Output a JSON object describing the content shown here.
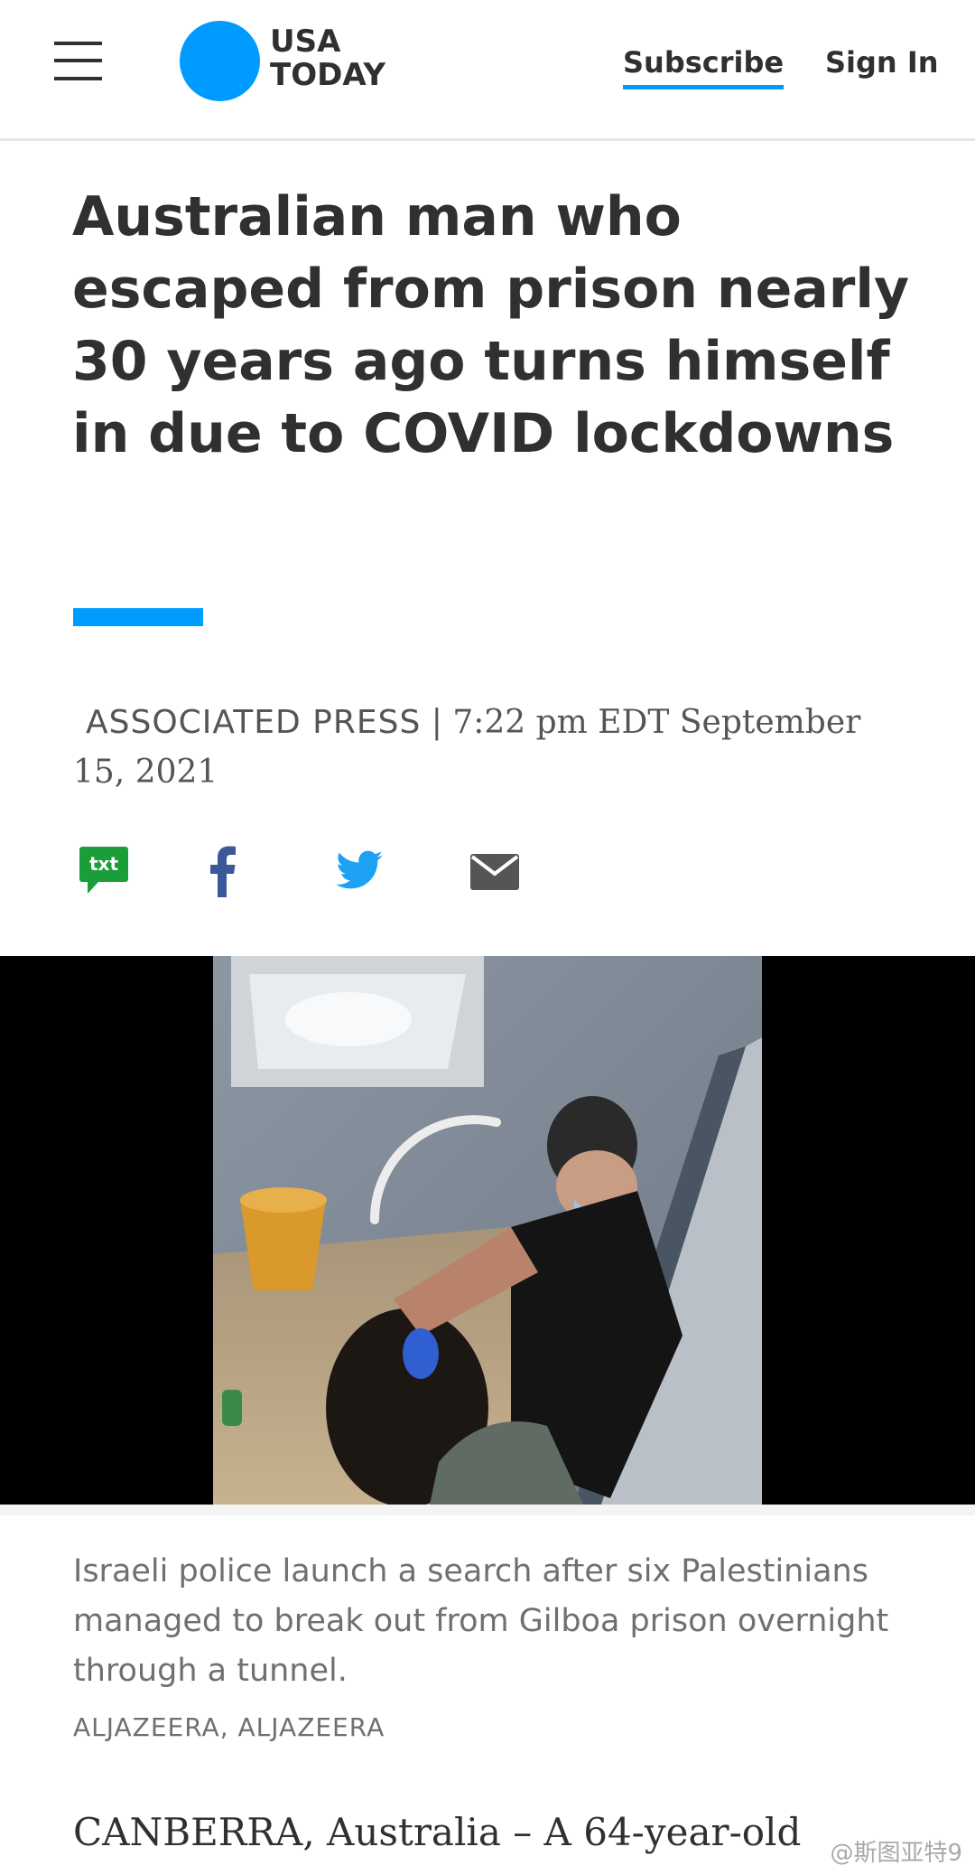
{
  "header": {
    "brand_line1": "USA",
    "brand_line2": "TODAY",
    "subscribe_label": "Subscribe",
    "signin_label": "Sign In"
  },
  "article": {
    "headline": "Australian man who escaped from prison nearly 30 years ago turns himself in due to COVID lockdowns",
    "byline_source": "ASSOCIATED PRESS",
    "byline_separator": " | ",
    "byline_date": "7:22 pm EDT September 15, 2021",
    "share": {
      "txt_label": "txt"
    },
    "media": {
      "caption": "Israeli police launch a search after six Palestinians managed to break out from Gilboa prison overnight through a tunnel.",
      "credit": "ALJAZEERA, ALJAZEERA"
    },
    "body_first_line": "CANBERRA, Australia – A 64-year-old"
  },
  "watermark": "@斯图亚特9",
  "colors": {
    "brand_blue": "#009bff",
    "text_dark": "#303030",
    "text_gray": "#707070",
    "txt_green": "#1a9e3a",
    "facebook_blue": "#3b5998",
    "twitter_blue": "#1da1f2",
    "mail_gray": "#555555"
  },
  "icons": [
    "menu-icon",
    "usa-today-logo",
    "txt-share-icon",
    "facebook-icon",
    "twitter-icon",
    "mail-icon",
    "loading-spinner-icon"
  ]
}
